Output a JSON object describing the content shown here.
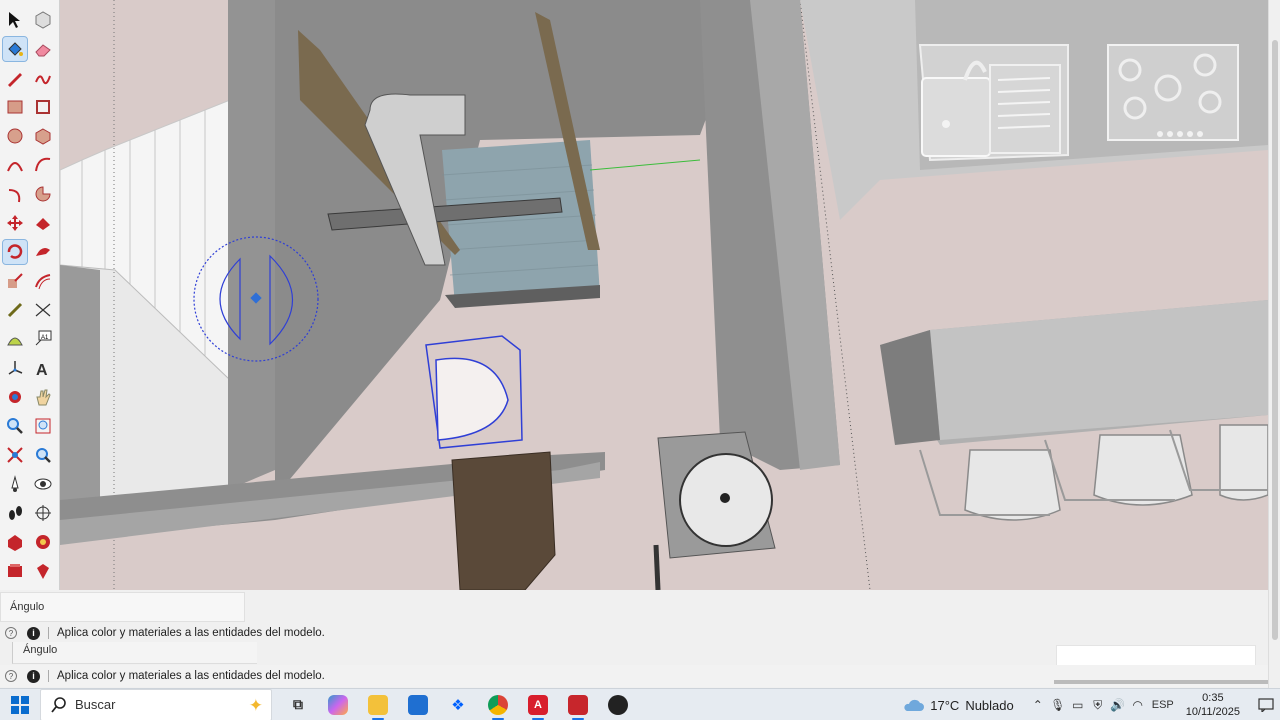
{
  "toolbar": {
    "tools": [
      {
        "id": "select",
        "icon": "select-arrow-icon",
        "active": false
      },
      {
        "id": "component",
        "icon": "make-component-icon",
        "active": false
      },
      {
        "id": "paint",
        "icon": "paint-bucket-icon",
        "active": true
      },
      {
        "id": "eraser",
        "icon": "eraser-icon",
        "active": false
      },
      {
        "id": "line",
        "icon": "line-pencil-icon",
        "active": false
      },
      {
        "id": "freehand",
        "icon": "freehand-icon",
        "active": false
      },
      {
        "id": "rectangle",
        "icon": "rectangle-icon",
        "active": false
      },
      {
        "id": "rotated-rect",
        "icon": "rotated-rectangle-icon",
        "active": false
      },
      {
        "id": "circle",
        "icon": "circle-icon",
        "active": false
      },
      {
        "id": "polygon",
        "icon": "polygon-icon",
        "active": false
      },
      {
        "id": "arc",
        "icon": "arc-icon",
        "active": false
      },
      {
        "id": "arc2",
        "icon": "two-point-arc-icon",
        "active": false
      },
      {
        "id": "arc3",
        "icon": "three-point-arc-icon",
        "active": false
      },
      {
        "id": "pie",
        "icon": "pie-icon",
        "active": false
      },
      {
        "id": "move",
        "icon": "move-icon",
        "active": false
      },
      {
        "id": "pushpull",
        "icon": "push-pull-icon",
        "active": false
      },
      {
        "id": "rotate",
        "icon": "rotate-icon",
        "active": true
      },
      {
        "id": "followme",
        "icon": "follow-me-icon",
        "active": false
      },
      {
        "id": "scale",
        "icon": "scale-icon",
        "active": false
      },
      {
        "id": "offset",
        "icon": "offset-icon",
        "active": false
      },
      {
        "id": "tape",
        "icon": "tape-measure-icon",
        "active": false
      },
      {
        "id": "dimension",
        "icon": "dimension-icon",
        "active": false
      },
      {
        "id": "protractor",
        "icon": "protractor-icon",
        "active": false
      },
      {
        "id": "text",
        "icon": "text-tool-icon",
        "active": false
      },
      {
        "id": "axes",
        "icon": "axes-icon",
        "active": false
      },
      {
        "id": "3dtext",
        "icon": "3d-text-icon",
        "active": false
      },
      {
        "id": "orbit",
        "icon": "orbit-icon",
        "active": false
      },
      {
        "id": "pan",
        "icon": "pan-hand-icon",
        "active": false
      },
      {
        "id": "zoom",
        "icon": "zoom-icon",
        "active": false
      },
      {
        "id": "zoomwindow",
        "icon": "zoom-window-icon",
        "active": false
      },
      {
        "id": "zoomextents",
        "icon": "zoom-extents-icon",
        "active": false
      },
      {
        "id": "previous",
        "icon": "previous-view-icon",
        "active": false
      },
      {
        "id": "position-camera",
        "icon": "position-camera-icon",
        "active": false
      },
      {
        "id": "lookaround",
        "icon": "look-around-icon",
        "active": false
      },
      {
        "id": "walk",
        "icon": "walk-icon",
        "active": false
      },
      {
        "id": "section",
        "icon": "section-plane-icon",
        "active": false
      },
      {
        "id": "warehouse",
        "icon": "3d-warehouse-icon",
        "active": false
      },
      {
        "id": "extension",
        "icon": "extension-warehouse-icon",
        "active": false
      },
      {
        "id": "layout",
        "icon": "send-to-layout-icon",
        "active": false
      },
      {
        "id": "ruby",
        "icon": "ruby-console-icon",
        "active": false
      }
    ]
  },
  "measurement": {
    "label": "Ángulo"
  },
  "measurement2": {
    "label": "Ángulo"
  },
  "status": {
    "message": "Aplica color y materiales a las entidades del modelo.",
    "message2": "Aplica color y materiales a las entidades del modelo."
  },
  "taskbar": {
    "search_placeholder": "Buscar",
    "apps": [
      {
        "name": "task-view",
        "icon": "task-view-icon"
      },
      {
        "name": "copilot",
        "icon": "copilot-icon"
      },
      {
        "name": "file-explorer",
        "icon": "folder-icon"
      },
      {
        "name": "store",
        "icon": "store-icon"
      },
      {
        "name": "dropbox",
        "icon": "dropbox-icon"
      },
      {
        "name": "chrome",
        "icon": "chrome-icon"
      },
      {
        "name": "autocad",
        "icon": "autocad-icon",
        "label": "A"
      },
      {
        "name": "sketchup",
        "icon": "sketchup-icon"
      },
      {
        "name": "obs",
        "icon": "obs-icon"
      }
    ],
    "weather": {
      "temp": "17°C",
      "condition": "Nublado"
    },
    "language": "ESP",
    "time": "0:35",
    "date": "10/11/2025"
  },
  "colors": {
    "accent": "#1a73e8",
    "protractor": "#2f3fd6",
    "floor": "#d8cac8",
    "wall": "#8c8c8c"
  }
}
